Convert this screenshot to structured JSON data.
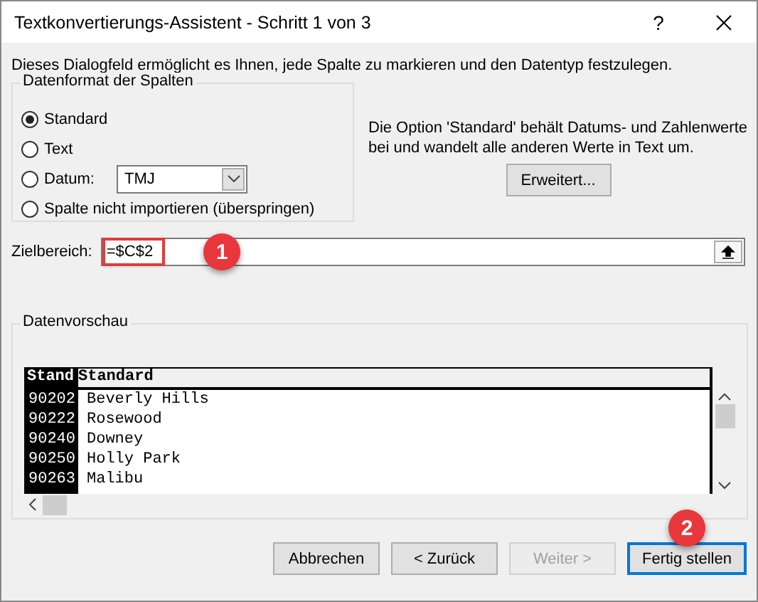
{
  "window": {
    "title": "Textkonvertierungs-Assistent - Schritt 1 von 3",
    "help": "?"
  },
  "intro": "Dieses Dialogfeld ermöglicht es Ihnen, jede Spalte zu markieren und den Datentyp festzulegen.",
  "format_group": {
    "title": "Datenformat der Spalten",
    "options": [
      {
        "label": "Standard",
        "selected": true
      },
      {
        "label": "Text",
        "selected": false
      },
      {
        "label": "Datum:",
        "selected": false,
        "dropdown": "TMJ"
      },
      {
        "label": "Spalte nicht importieren (überspringen)",
        "selected": false
      }
    ]
  },
  "note": "Die Option 'Standard' behält Datums- und Zahlenwerte bei und wandelt alle anderen Werte in Text um.",
  "advanced_button": "Erweitert...",
  "target": {
    "label": "Zielbereich:",
    "value": "=$C$2",
    "highlighted": true
  },
  "callouts": [
    "1",
    "2"
  ],
  "preview": {
    "title": "Datenvorschau",
    "columns": [
      {
        "header": "Stand",
        "selected": true
      },
      {
        "header": "Standard",
        "selected": false
      }
    ],
    "rows": [
      [
        "90202",
        "Beverly Hills"
      ],
      [
        "90222",
        "Rosewood"
      ],
      [
        "90240",
        "Downey"
      ],
      [
        "90250",
        "Holly Park"
      ],
      [
        "90263",
        "Malibu"
      ]
    ]
  },
  "buttons": [
    {
      "label": "Abbrechen",
      "disabled": false,
      "default": false
    },
    {
      "label": "< Zurück",
      "disabled": false,
      "default": false
    },
    {
      "label": "Weiter >",
      "disabled": true,
      "default": false
    },
    {
      "label": "Fertig stellen",
      "disabled": false,
      "default": true
    }
  ]
}
